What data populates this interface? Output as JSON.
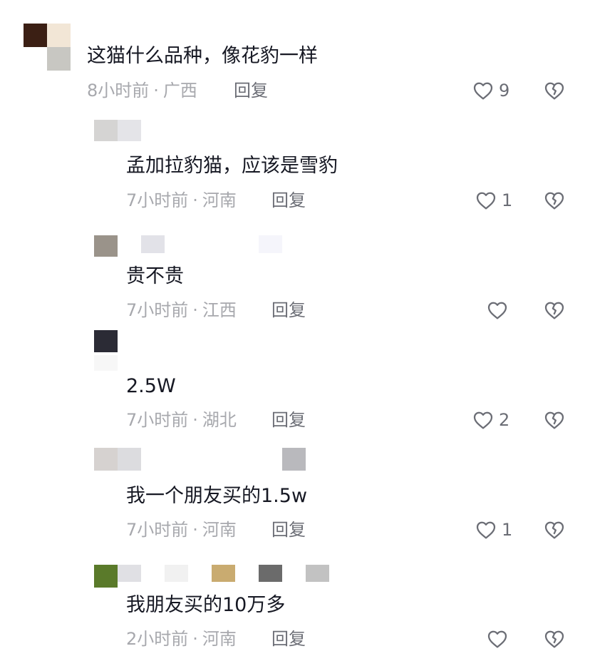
{
  "comments": [
    {
      "text": "这猫什么品种，像花豹一样",
      "time": "8小时前",
      "location": "广西",
      "reply_label": "回复",
      "likes": "9"
    },
    {
      "text": "孟加拉豹猫，应该是雪豹",
      "time": "7小时前",
      "location": "河南",
      "reply_label": "回复",
      "likes": "1"
    },
    {
      "text": "贵不贵",
      "time": "7小时前",
      "location": "江西",
      "reply_label": "回复",
      "likes": ""
    },
    {
      "text": "2.5W",
      "time": "7小时前",
      "location": "湖北",
      "reply_label": "回复",
      "likes": "2"
    },
    {
      "text": "我一个朋友买的1.5w",
      "time": "7小时前",
      "location": "河南",
      "reply_label": "回复",
      "likes": "1"
    },
    {
      "text": "我朋友买的10万多",
      "time": "2小时前",
      "location": "河南",
      "reply_label": "回复",
      "likes": ""
    }
  ],
  "separator": "·",
  "icons": {
    "like": "heart-outline-icon",
    "dislike": "broken-heart-icon"
  },
  "colors": {
    "text": "#161823",
    "meta": "#a7a8ad",
    "reply": "#6b6d75",
    "icon": "#6b6d75"
  }
}
